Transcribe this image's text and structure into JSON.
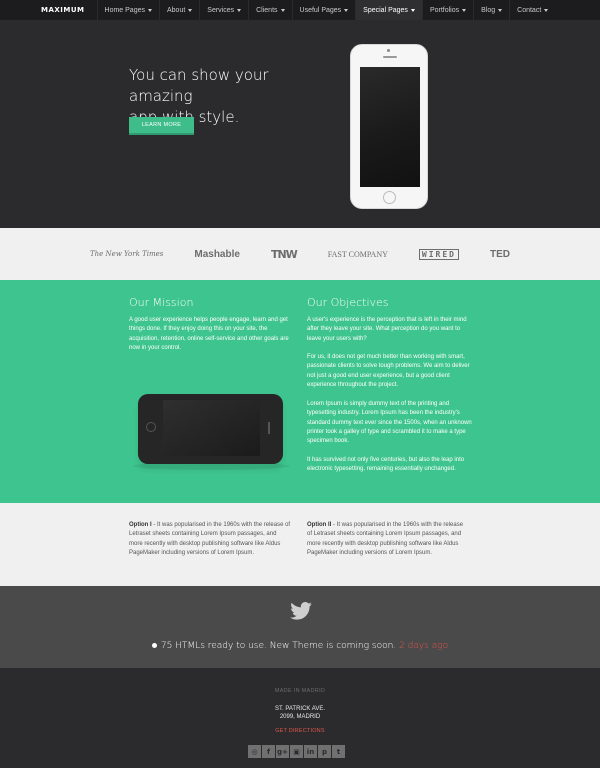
{
  "nav": {
    "logo": "MAXIMUM",
    "items": [
      {
        "label": "Home Pages"
      },
      {
        "label": "About"
      },
      {
        "label": "Services"
      },
      {
        "label": "Clients"
      },
      {
        "label": "Useful Pages"
      },
      {
        "label": "Special Pages"
      },
      {
        "label": "Portfolios"
      },
      {
        "label": "Blog"
      },
      {
        "label": "Contact"
      }
    ],
    "active_index": 5
  },
  "hero": {
    "title_line1": "You can show your amazing",
    "title_line2": "app with style.",
    "button": "LEARN MORE"
  },
  "logos": [
    "The New York Times",
    "Mashable",
    "TNW",
    "FAST COMPANY",
    "WIRED",
    "TED"
  ],
  "mission": {
    "title": "Our Mission",
    "text": "A good user experience helps people engage, learn and get things done. If they enjoy doing this on your site, the acquisition, retention, online self-service and other goals are now in your control."
  },
  "objectives": {
    "title": "Our Objectives",
    "p1": "A user's experience is the perception that is left in their mind after they leave your site. What perception do you want to leave your users with?",
    "p2": "For us, it does not get much better than working with smart, passionate clients to solve tough problems. We aim to deliver not just a good end user experience, but a good client experience throughout the project.",
    "p3": "Lorem Ipsum is simply dummy text of the printing and typesetting industry. Lorem Ipsum has been the industry's standard dummy text ever since the 1500s, when an unknown printer took a galley of type and scrambled it to make a type specimen book.",
    "p4": "It has survived not only five centuries, but also the leap into electronic typesetting, remaining essentially unchanged."
  },
  "options": [
    {
      "label": "Option I",
      "text": " - It was popularised in the 1960s with the release of Letraset sheets containing Lorem Ipsum passages, and more recently with desktop publishing software like Aldus PageMaker including versions of Lorem Ipsum."
    },
    {
      "label": "Option II",
      "text": " - It was popularised in the 1960s with the release of Letraset sheets containing Lorem Ipsum passages, and more recently with desktop publishing software like Aldus PageMaker including versions of Lorem Ipsum."
    }
  ],
  "twitter": {
    "text": "75 HTMLs ready to use. New Theme is coming soon.",
    "time": "2 days ago"
  },
  "footer": {
    "made_in": "MADE IN MADRID",
    "address_line1": "ST. PATRICK AVE.",
    "address_line2": "2099, MADRID",
    "directions": "GET DIRECTIONS",
    "social_icons": [
      "dribbble-icon",
      "facebook-icon",
      "google-plus-icon",
      "instagram-icon",
      "linkedin-icon",
      "pinterest-icon",
      "twitter-icon"
    ],
    "social_glyphs": [
      "◎",
      "f",
      "g+",
      "▣",
      "in",
      "p",
      "t"
    ]
  },
  "colors": {
    "accent_green": "#3ec48e",
    "dark_bg": "#2b2b2d",
    "link_red": "#e0564b"
  }
}
